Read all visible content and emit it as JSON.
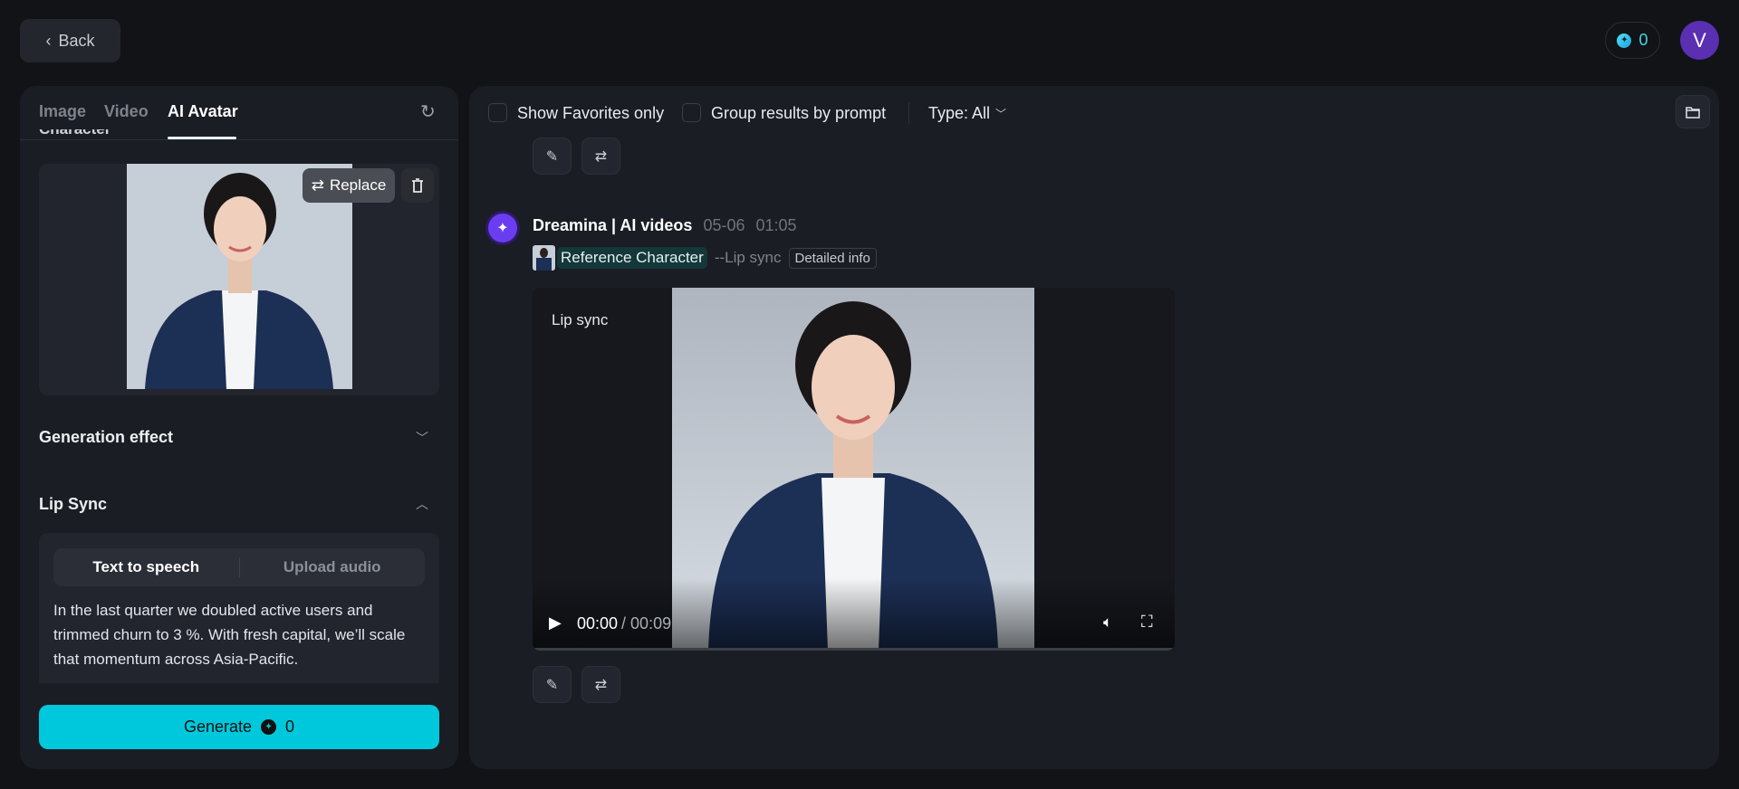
{
  "header": {
    "back_label": "Back",
    "credits": "0",
    "avatar_initial": "V"
  },
  "left_panel": {
    "tabs": [
      {
        "label": "Image"
      },
      {
        "label": "Video"
      },
      {
        "label": "AI Avatar",
        "active": true
      }
    ],
    "character_label": "Character",
    "replace_label": "Replace",
    "generation_effect_label": "Generation effect",
    "lip_sync_label": "Lip Sync",
    "lip_sync_modes": [
      "Text to speech",
      "Upload audio"
    ],
    "active_mode": "Text to speech",
    "tts_text": "In the last quarter we doubled active users and trimmed churn to 3 %. With fresh capital, we’ll scale that momentum across Asia-Pacific.",
    "generate_label": "Generate",
    "generate_cost": "0"
  },
  "toolbar": {
    "show_favorites_label": "Show Favorites only",
    "group_by_prompt_label": "Group results by prompt",
    "type_filter_label": "Type: All"
  },
  "result": {
    "author": "Dreamina | AI videos",
    "date": "05-06",
    "time": "01:05",
    "reference_label": "Reference Character",
    "mode_label": "--Lip sync",
    "detail_label": "Detailed info",
    "video_overlay_label": "Lip sync",
    "current_time": "00:00",
    "duration": "/ 00:09"
  },
  "colors": {
    "accent": "#00c8dc",
    "avatar": "#5a2fb2",
    "brand": "#7b4dff"
  }
}
